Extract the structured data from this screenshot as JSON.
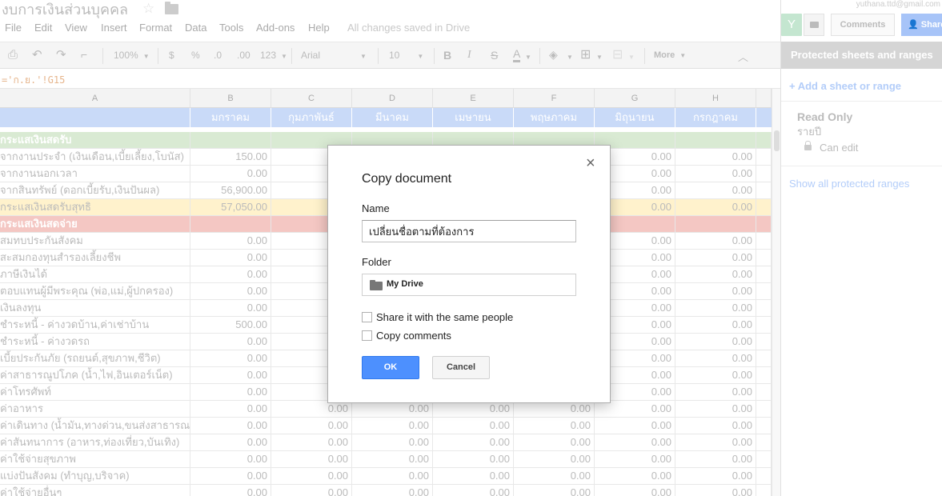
{
  "header": {
    "doc_title": "งบการเงินส่วนบุคคล",
    "star_icon": "star-icon",
    "folder_icon": "folder-icon"
  },
  "menu": [
    "File",
    "Edit",
    "View",
    "Insert",
    "Format",
    "Data",
    "Tools",
    "Add-ons",
    "Help"
  ],
  "save_status": "All changes saved in Drive",
  "toolbar": {
    "zoom": "100%",
    "currency": "$",
    "percent": "%",
    "decrease_decimals": ".0",
    "increase_decimals": ".00",
    "number_format": "123",
    "font": "Arial",
    "font_size": "10",
    "bold": "B",
    "italic": "I",
    "strikethrough": "S",
    "text_color": "A",
    "more": "More"
  },
  "formula": "='ก.ย.'!G15",
  "grid": {
    "columns": [
      "A",
      "B",
      "C",
      "D",
      "E",
      "F",
      "G",
      "H"
    ],
    "months": [
      "",
      "มกราคม",
      "กุมภาพันธ์",
      "มีนาคม",
      "เมษายน",
      "พฤษภาคม",
      "มิถุนายน",
      "กรกฎาคม"
    ],
    "rows": [
      {
        "style": "section-green",
        "label": "กระแสเงินสดรับ",
        "values": [
          "",
          "",
          "",
          "",
          "",
          "",
          ""
        ]
      },
      {
        "style": "",
        "label": "จากงานประจำ (เงินเดือน,เบี้ยเลี้ยง,โบนัส)",
        "values": [
          "150.00",
          "",
          "",
          "",
          "",
          "0.00",
          "0.00"
        ]
      },
      {
        "style": "",
        "label": "จากงานนอกเวลา",
        "values": [
          "0.00",
          "",
          "",
          "",
          "",
          "0.00",
          "0.00"
        ]
      },
      {
        "style": "",
        "label": "จากสินทรัพย์ (ดอกเบี้ยรับ,เงินปันผล)",
        "values": [
          "56,900.00",
          "",
          "",
          "",
          "",
          "0.00",
          "0.00"
        ]
      },
      {
        "style": "total",
        "label": "กระแสเงินสดรับสุทธิ",
        "values": [
          "57,050.00",
          "",
          "",
          "",
          "",
          "0.00",
          "0.00"
        ]
      },
      {
        "style": "section-red",
        "label": "กระแสเงินสดจ่าย",
        "values": [
          "",
          "",
          "",
          "",
          "",
          "",
          ""
        ]
      },
      {
        "style": "",
        "label": "สมทบประกันสังคม",
        "values": [
          "0.00",
          "",
          "",
          "",
          "",
          "0.00",
          "0.00"
        ]
      },
      {
        "style": "",
        "label": "สะสมกองทุนสำรองเลี้ยงชีพ",
        "values": [
          "0.00",
          "",
          "",
          "",
          "",
          "0.00",
          "0.00"
        ]
      },
      {
        "style": "",
        "label": "ภาษีเงินได้",
        "values": [
          "0.00",
          "",
          "",
          "",
          "",
          "0.00",
          "0.00"
        ]
      },
      {
        "style": "",
        "label": "ตอบแทนผู้มีพระคุณ (พ่อ,แม่,ผู้ปกครอง)",
        "values": [
          "0.00",
          "",
          "",
          "",
          "",
          "0.00",
          "0.00"
        ]
      },
      {
        "style": "",
        "label": "เงินลงทุน",
        "values": [
          "0.00",
          "",
          "",
          "",
          "",
          "0.00",
          "0.00"
        ]
      },
      {
        "style": "",
        "label": "ชำระหนี้ - ค่างวดบ้าน,ค่าเช่าบ้าน",
        "values": [
          "500.00",
          "",
          "",
          "",
          "",
          "0.00",
          "0.00"
        ]
      },
      {
        "style": "",
        "label": "ชำระหนี้ - ค่างวดรถ",
        "values": [
          "0.00",
          "",
          "",
          "",
          "",
          "0.00",
          "0.00"
        ]
      },
      {
        "style": "",
        "label": "เบี้ยประกันภัย (รถยนต์,สุขภาพ,ชีวิต)",
        "values": [
          "0.00",
          "",
          "",
          "",
          "",
          "0.00",
          "0.00"
        ]
      },
      {
        "style": "",
        "label": "ค่าสาธารณูปโภค (น้ำ,ไฟ,อินเตอร์เน็ต)",
        "values": [
          "0.00",
          "",
          "",
          "",
          "",
          "0.00",
          "0.00"
        ]
      },
      {
        "style": "",
        "label": "ค่าโทรศัพท์",
        "values": [
          "0.00",
          "",
          "",
          "",
          "",
          "0.00",
          "0.00"
        ]
      },
      {
        "style": "",
        "label": "ค่าอาหาร",
        "values": [
          "0.00",
          "0.00",
          "0.00",
          "0.00",
          "0.00",
          "0.00",
          "0.00"
        ]
      },
      {
        "style": "",
        "label": "ค่าเดินทาง (น้ำมัน,ทางด่วน,ขนส่งสาธารณะ)",
        "values": [
          "0.00",
          "0.00",
          "0.00",
          "0.00",
          "0.00",
          "0.00",
          "0.00"
        ]
      },
      {
        "style": "",
        "label": "ค่าสันทนาการ (อาหาร,ท่องเที่ยว,บันเทิง)",
        "values": [
          "0.00",
          "0.00",
          "0.00",
          "0.00",
          "0.00",
          "0.00",
          "0.00"
        ]
      },
      {
        "style": "",
        "label": "ค่าใช้จ่ายสุขภาพ",
        "values": [
          "0.00",
          "0.00",
          "0.00",
          "0.00",
          "0.00",
          "0.00",
          "0.00"
        ]
      },
      {
        "style": "",
        "label": "แบ่งปันสังคม (ทำบุญ,บริจาค)",
        "values": [
          "0.00",
          "0.00",
          "0.00",
          "0.00",
          "0.00",
          "0.00",
          "0.00"
        ]
      },
      {
        "style": "",
        "label": "ค่าใช้จ่ายอื่นๆ",
        "values": [
          "0.00",
          "0.00",
          "0.00",
          "0.00",
          "0.00",
          "0.00",
          "0.00"
        ]
      }
    ]
  },
  "side_panel": {
    "account_email": "yuthana.ttd@gmail.com",
    "comments_label": "Comments",
    "share_label": "Share",
    "title": "Protected sheets and ranges",
    "add_range": "+ Add a sheet or range",
    "range_title": "Read Only",
    "range_sheet": "รายปี",
    "range_permission": "Can edit",
    "show_all": "Show all protected ranges"
  },
  "dialog": {
    "title": "Copy document",
    "close_glyph": "×",
    "name_label": "Name",
    "name_value": "เปลี่ยนชื่อตามที่ต้องการ",
    "folder_label": "Folder",
    "folder_value": "My Drive",
    "share_checkbox": "Share it with the same people",
    "comments_checkbox": "Copy comments",
    "ok": "OK",
    "cancel": "Cancel"
  }
}
